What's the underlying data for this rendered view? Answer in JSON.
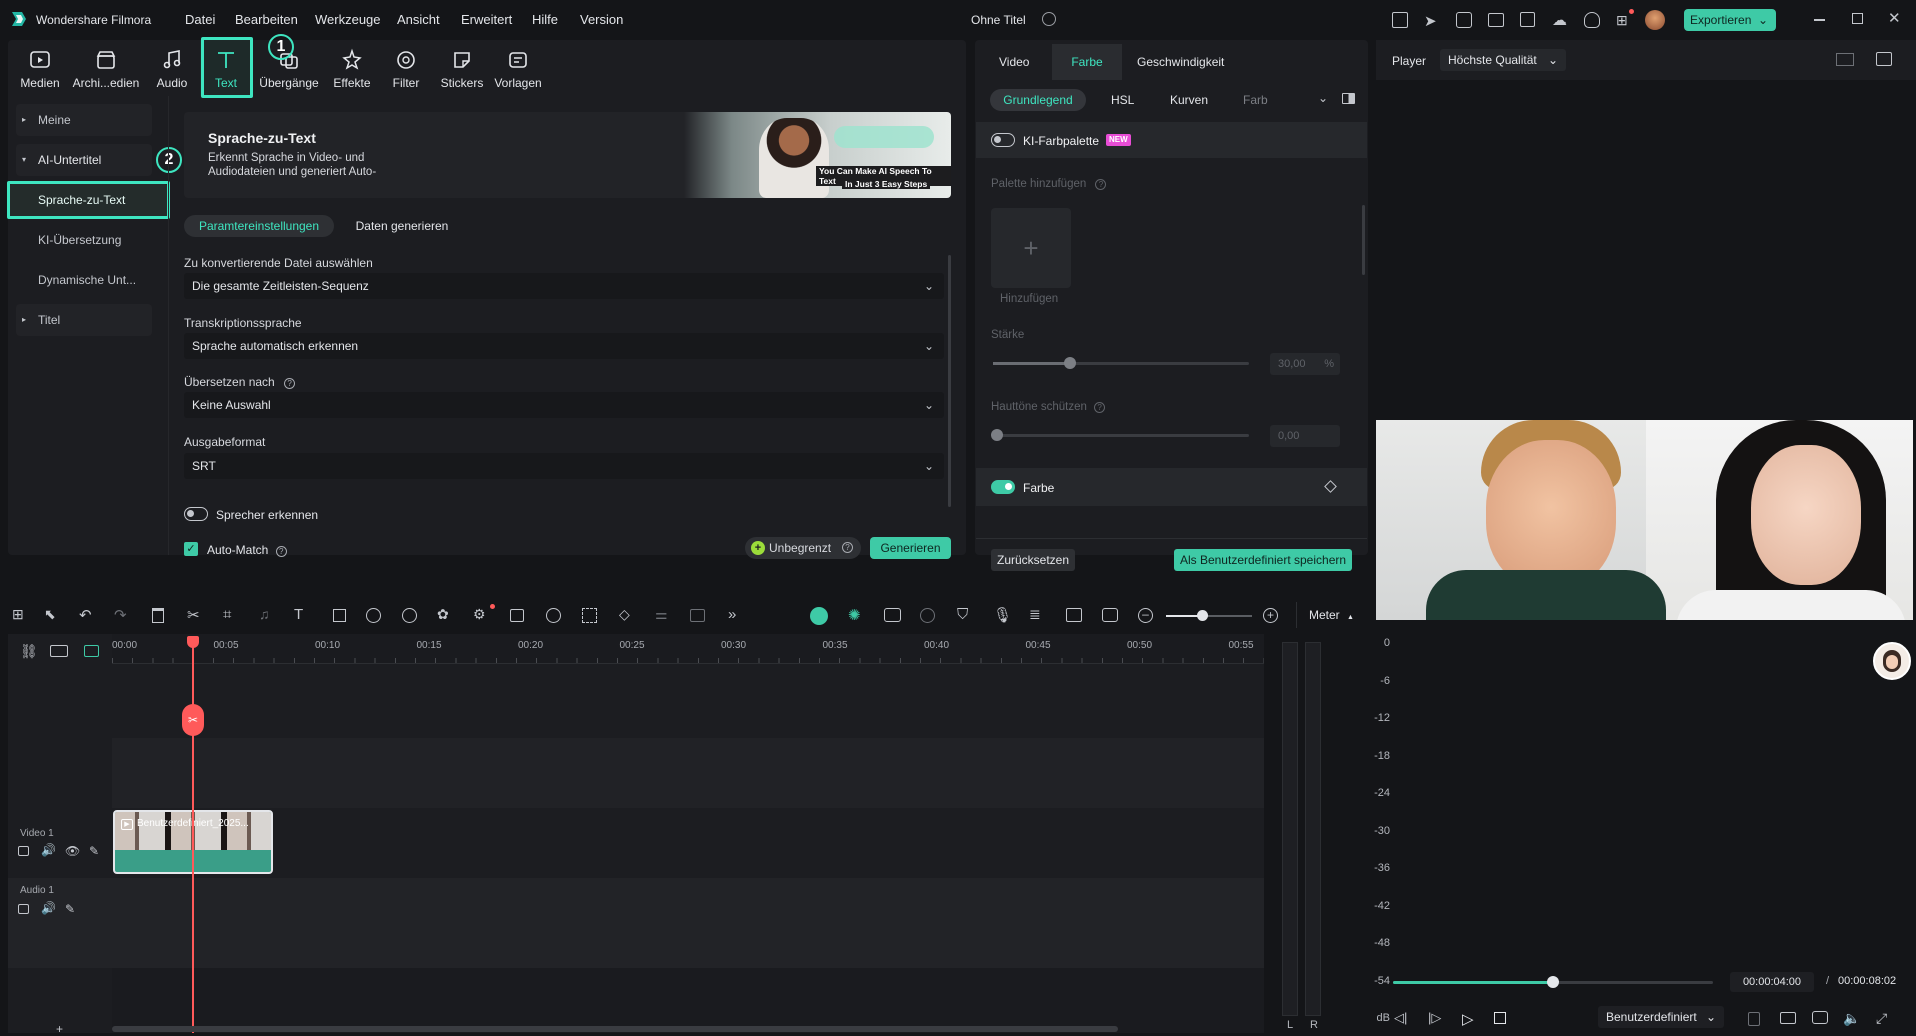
{
  "app": {
    "name": "Wondershare Filmora",
    "project_title": "Ohne Titel",
    "export_label": "Exportieren"
  },
  "menu": [
    "Datei",
    "Bearbeiten",
    "Werkzeuge",
    "Ansicht",
    "Erweitert",
    "Hilfe",
    "Version"
  ],
  "toolbar": [
    {
      "label": "Medien",
      "icon": "media-icon"
    },
    {
      "label": "Archi...edien",
      "icon": "archive-media-icon"
    },
    {
      "label": "Audio",
      "icon": "audio-note-icon"
    },
    {
      "label": "Text",
      "icon": "text-t-icon"
    },
    {
      "label": "Übergänge",
      "icon": "transitions-icon"
    },
    {
      "label": "Effekte",
      "icon": "effects-icon"
    },
    {
      "label": "Filter",
      "icon": "filter-icon"
    },
    {
      "label": "Stickers",
      "icon": "sticker-icon"
    },
    {
      "label": "Vorlagen",
      "icon": "templates-icon"
    }
  ],
  "sidebar": {
    "items": [
      {
        "label": "Meine"
      },
      {
        "label": "AI-Untertitel"
      },
      {
        "label": "Sprache-zu-Text"
      },
      {
        "label": "KI-Übersetzung"
      },
      {
        "label": "Dynamische Unt..."
      },
      {
        "label": "Titel"
      }
    ]
  },
  "annotations": {
    "badge1": "1",
    "badge2": "2"
  },
  "stt": {
    "title": "Sprache-zu-Text",
    "description_line1": "Erkennt Sprache in Video- und",
    "description_line2": "Audiodateien und generiert Auto-",
    "banner_line1": "You Can Make AI Speech To Text",
    "banner_line2": "In Just  3 Easy Steps",
    "tabs": [
      "Paramtereinstellungen",
      "Daten generieren"
    ],
    "fields": [
      {
        "label": "Zu konvertierende Datei auswählen",
        "value": "Die gesamte Zeitleisten-Sequenz"
      },
      {
        "label": "Transkriptionssprache",
        "value": "Sprache automatisch erkennen"
      },
      {
        "label": "Übersetzen nach",
        "value": "Keine Auswahl"
      },
      {
        "label": "Ausgabeformat",
        "value": "SRT"
      }
    ],
    "speaker_label": "Sprecher erkennen",
    "automatch_label": "Auto-Match",
    "unlimited_label": "Unbegrenzt",
    "generate_label": "Generieren"
  },
  "props": {
    "tabs": [
      "Video",
      "Farbe",
      "Geschwindigkeit"
    ],
    "subtabs": [
      "Grundlegend",
      "HSL",
      "Kurven",
      "Farb"
    ],
    "ai_palette": "KI-Farbpalette",
    "new_badge": "NEW",
    "add_palette": "Palette hinzufügen",
    "add": "Hinzufügen",
    "strength_label": "Stärke",
    "strength_value": "30,00",
    "strength_unit": "%",
    "strength_fraction": 0.3,
    "skin_label": "Hauttöne schützen",
    "skin_value": "0,00",
    "color_label": "Farbe",
    "reset": "Zurücksetzen",
    "save_custom": "Als Benutzerdefiniert speichern"
  },
  "player": {
    "label": "Player",
    "quality": "Höchste Qualität",
    "current_time": "00:00:04:00",
    "separator": "/",
    "total_time": "00:00:08:02",
    "progress_fraction": 0.5,
    "ratio_label": "Benutzerdefiniert"
  },
  "timeline": {
    "ruler": [
      "00:00",
      "00:05",
      "00:10",
      "00:15",
      "00:20",
      "00:25",
      "00:30",
      "00:35",
      "00:40",
      "00:45",
      "00:50",
      "00:55"
    ],
    "video_track": "Video 1",
    "audio_track": "Audio 1",
    "clip_label": "Benutzerdefiniert_2025...",
    "meter_label": "Meter",
    "meter_scale": [
      "0",
      "-6",
      "-12",
      "-18",
      "-24",
      "-30",
      "-36",
      "-42",
      "-48",
      "-54",
      "dB"
    ],
    "meter_channels": [
      "L",
      "R"
    ]
  },
  "colors": {
    "accent": "#3ee6c1",
    "accent_button": "#3ecaa6",
    "playhead": "#ff5a5a",
    "bg": "#141518",
    "panel": "#1c1d21"
  }
}
